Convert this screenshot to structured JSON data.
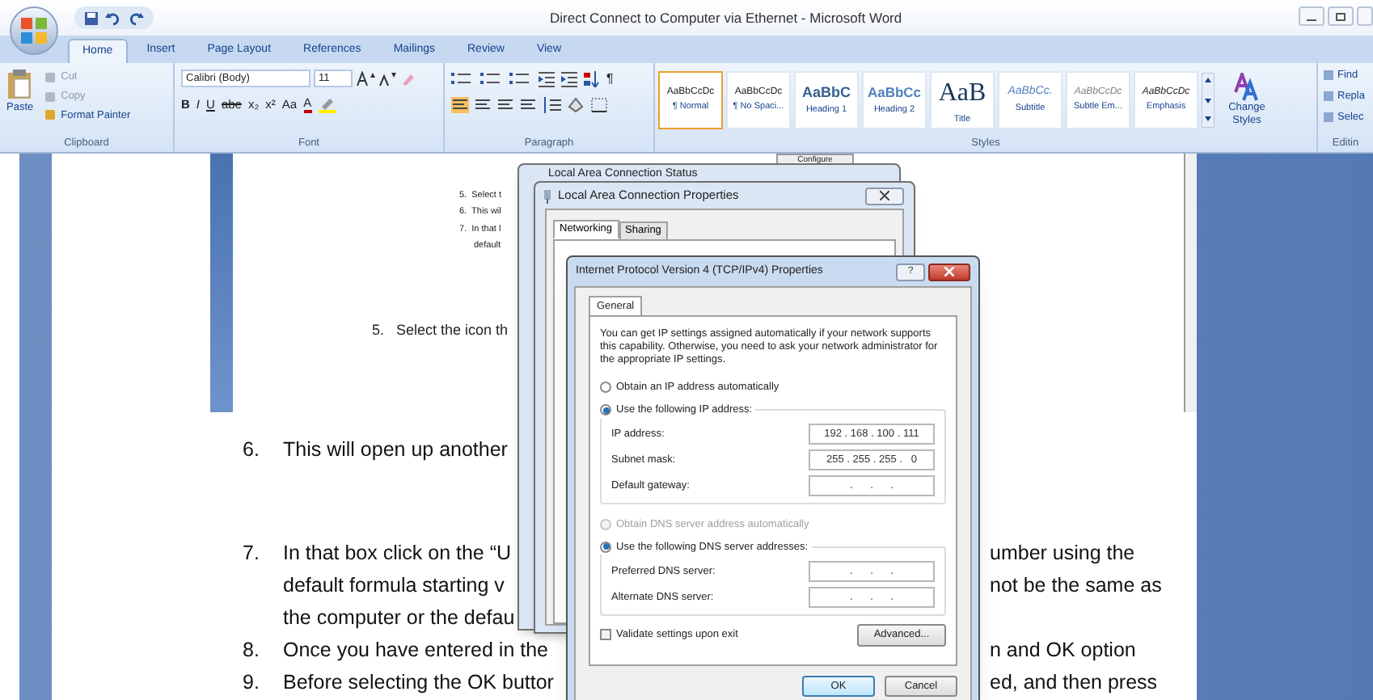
{
  "window": {
    "title": "Direct Connect to Computer via Ethernet - Microsoft Word"
  },
  "tabs": [
    {
      "label": "Home",
      "selected": true
    },
    {
      "label": "Insert",
      "selected": false
    },
    {
      "label": "Page Layout",
      "selected": false
    },
    {
      "label": "References",
      "selected": false
    },
    {
      "label": "Mailings",
      "selected": false
    },
    {
      "label": "Review",
      "selected": false
    },
    {
      "label": "View",
      "selected": false
    }
  ],
  "ribbon": {
    "clipboard": {
      "label": "Clipboard",
      "paste": "Paste",
      "items": [
        "Cut",
        "Copy",
        "Format Painter"
      ]
    },
    "font": {
      "label": "Font",
      "name": "Calibri (Body)",
      "size": "11",
      "format_buttons": [
        "B",
        "I",
        "U",
        "abe",
        "x₂",
        "x²",
        "Aa",
        "A"
      ]
    },
    "paragraph": {
      "label": "Paragraph",
      "show_marks": "¶"
    },
    "styles": {
      "label": "Styles",
      "change": "Change Styles",
      "items": [
        {
          "preview": "AaBbCcDc",
          "name": "¶ Normal",
          "selected": true
        },
        {
          "preview": "AaBbCcDc",
          "name": "¶ No Spaci...",
          "selected": false
        },
        {
          "preview": "AaBbC",
          "name": "Heading 1",
          "selected": false
        },
        {
          "preview": "AaBbCc",
          "name": "Heading 2",
          "selected": false
        },
        {
          "preview": "AaB",
          "name": "Title",
          "selected": false
        },
        {
          "preview": "AaBbCc.",
          "name": "Subtitle",
          "selected": false
        },
        {
          "preview": "AaBbCcDc",
          "name": "Subtle Em...",
          "selected": false
        },
        {
          "preview": "AaBbCcDc",
          "name": "Emphasis",
          "selected": false
        }
      ]
    },
    "editing": {
      "label": "Editin",
      "items": [
        "Find",
        "Repla",
        "Selec"
      ]
    }
  },
  "document": {
    "image_steps": [
      "5.  Select t",
      "6.  This wil",
      "7.  In that l",
      "default"
    ],
    "configure": "Configure",
    "image_caption": "5.   Select the icon th",
    "lines": [
      {
        "number": "6.",
        "text": "This will open up another"
      },
      {
        "number": "7.",
        "text": "In that box click on the “U",
        "right": "umber using the"
      },
      {
        "text": "default formula starting v",
        "right": "not be the same as"
      },
      {
        "text": "the computer or the defau"
      },
      {
        "number": "8.",
        "text": "Once you have entered in the",
        "right": "n and OK option"
      },
      {
        "number": "9.",
        "text": "Before selecting the OK buttor",
        "right": "ed, and then press"
      }
    ]
  },
  "status_dialog": {
    "title": "Local Area Connection Status"
  },
  "properties_dialog": {
    "title": "Local Area Connection Properties",
    "tabs": [
      {
        "label": "Networking",
        "selected": true
      },
      {
        "label": "Sharing",
        "selected": false
      }
    ]
  },
  "ipv4_dialog": {
    "title": "Internet Protocol Version 4 (TCP/IPv4) Properties",
    "help": "?",
    "tabs": [
      {
        "label": "General",
        "selected": true
      }
    ],
    "description": "You can get IP settings assigned automatically if your network supports this capability. Otherwise, you need to ask your network administrator for the appropriate IP settings.",
    "ip_options": [
      {
        "label": "Obtain an IP address automatically",
        "selected": false,
        "disabled": false
      },
      {
        "label": "Use the following IP address:",
        "selected": true,
        "disabled": false
      }
    ],
    "ip_fields": [
      {
        "label": "IP address:",
        "value": "192 . 168 . 100 . 111"
      },
      {
        "label": "Subnet mask:",
        "value": "255 . 255 . 255 .   0"
      },
      {
        "label": "Default gateway:",
        "value": ".      .      ."
      }
    ],
    "dns_options": [
      {
        "label": "Obtain DNS server address automatically",
        "selected": false,
        "disabled": true
      },
      {
        "label": "Use the following DNS server addresses:",
        "selected": true,
        "disabled": false
      }
    ],
    "dns_fields": [
      {
        "label": "Preferred DNS server:",
        "value": ".      .      ."
      },
      {
        "label": "Alternate DNS server:",
        "value": ".      .      ."
      }
    ],
    "validate": {
      "label": "Validate settings upon exit",
      "checked": false
    },
    "advanced": "Advanced...",
    "buttons": [
      "OK",
      "Cancel"
    ]
  }
}
